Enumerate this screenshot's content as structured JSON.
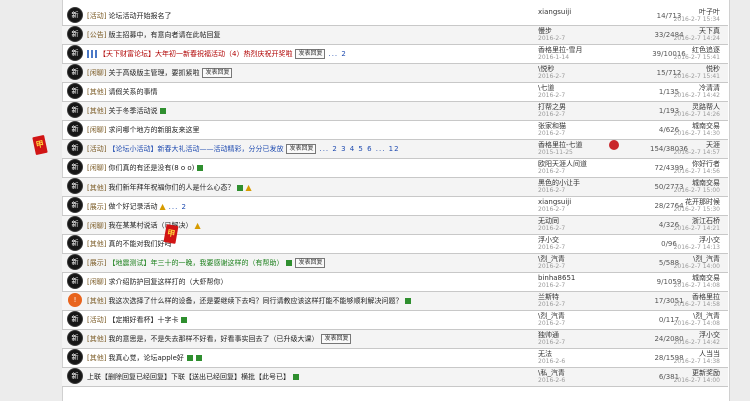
{
  "decor": {
    "envelope_glyph": "甲",
    "envelope_glyph2": "甲"
  },
  "rows": [
    {
      "badge": "新",
      "cat": "[活动]",
      "title": "论坛活动开始报名了",
      "flags": [],
      "author": "xiangsuiji",
      "date": "",
      "replies": "14/713",
      "last_user": "叶子叶",
      "last_date": "2016-2-7 15:34"
    },
    {
      "badge": "新",
      "cat": "[公告]",
      "title": "版主招募中，有意向者请在此帖回复",
      "flags": [],
      "author": "慢步",
      "date": "2016-2-7",
      "replies": "33/2484",
      "last_user": "天下真",
      "last_date": "2016-2-7 14:24"
    },
    {
      "badge": "新",
      "cat": "",
      "title": "【天下财富论坛】大年初一新春祝福活动（4）热烈庆祝开奖啦",
      "flags": [
        "chip",
        "pages"
      ],
      "chip": "发表回复",
      "pages": "... 2",
      "author": "香格里拉-雪月",
      "date": "2016-1-14",
      "replies": "39/10016",
      "last_user": "红色追逐",
      "last_date": "2016-2-7 15:41"
    },
    {
      "badge": "新",
      "cat": "[闲聊]",
      "title": "关于高级版主管理，要抓紧啦",
      "flags": [
        "chip"
      ],
      "chip": "发表回复",
      "author": "\\悦秒",
      "date": "2016-2-7",
      "replies": "15/712",
      "last_user": "悦秒",
      "last_date": "2016-2-7 15:41"
    },
    {
      "badge": "新",
      "cat": "[其他]",
      "title": "请假关系的事情",
      "flags": [],
      "author": "\\七道",
      "date": "2016-2-7",
      "replies": "1/135",
      "last_user": "冷清清",
      "last_date": "2016-2-7 14:42"
    },
    {
      "badge": "新",
      "cat": "[其他]",
      "title": "关于冬季活动说",
      "flags": [
        "sq"
      ],
      "author": "打帮之男",
      "date": "2016-2-7",
      "replies": "1/193",
      "last_user": "灵路帮人",
      "last_date": "2016-2-7 14:26"
    },
    {
      "badge": "新",
      "cat": "[闲聊]",
      "title": "求问哪个地方的新朋友来这里",
      "flags": [],
      "author": "张家和猫",
      "date": "2016-2-7",
      "replies": "4/626",
      "last_user": "城南交易",
      "last_date": "2016-2-7 14:30"
    },
    {
      "badge": "新",
      "cat": "[活动]",
      "title": "【论坛小活动】新春大礼活动——活动精彩，分分已发放",
      "flags": [
        "chip",
        "pages"
      ],
      "chip": "发表回复",
      "pages": "... 2 3 4 5 6 ... 12",
      "author": "香格里拉-七道",
      "date": "2015-11-25",
      "replies": "154/38036",
      "last_user": "天涯",
      "last_date": "2016-2-7 14:57"
    },
    {
      "badge": "新",
      "cat": "[闲聊]",
      "title": "你们真的有还是没有(8 o o)",
      "flags": [
        "sq"
      ],
      "author": "欧阳天涯人间道",
      "date": "2016-2-7",
      "replies": "72/4399",
      "last_user": "你好行者",
      "last_date": "2016-2-7 14:56"
    },
    {
      "badge": "新",
      "cat": "[其他]",
      "title": "我们新年拜年祝福你们的人是什么心态？",
      "flags": [
        "sq",
        "thumb"
      ],
      "author": "黑色的小让手",
      "date": "2016-2-7",
      "replies": "50/2773",
      "last_user": "城南交易",
      "last_date": "2016-2-7 15:00"
    },
    {
      "badge": "新",
      "cat": "[展示]",
      "title": "做个好记录活动",
      "flags": [
        "thumb",
        "pages"
      ],
      "pages": "... 2",
      "author": "xiangsuiji",
      "date": "2016-2-7",
      "replies": "28/2764",
      "last_user": "花开那时候",
      "last_date": "2016-2-7 15:30"
    },
    {
      "badge": "新",
      "cat": "[闲聊]",
      "title": "我在某某村说话（已解决）",
      "flags": [
        "thumb"
      ],
      "author": "无动同",
      "date": "2016-2-7",
      "replies": "4/326",
      "last_user": "浙江石桥",
      "last_date": "2016-2-7 14:21"
    },
    {
      "badge": "新",
      "cat": "[其他]",
      "title": "真的不能对我们好吗",
      "flags": [],
      "author": "浮小交",
      "date": "2016-2-7",
      "replies": "0/96",
      "last_user": "浮小交",
      "last_date": "2016-2-7 14:13"
    },
    {
      "badge": "新",
      "cat": "[展示]",
      "title": "【地震测试】年三十的一晚，我要感谢这样的（有帮助）",
      "flags": [
        "sq",
        "chip"
      ],
      "chip": "发表回复",
      "author": "\\烈_汽青",
      "date": "2016-2-7",
      "replies": "5/588",
      "last_user": "\\烈_汽青",
      "last_date": "2016-2-7 14:00"
    },
    {
      "badge": "新",
      "cat": "[闲聊]",
      "title": "求介绍防护回复这样打的（大虾帮你）",
      "flags": [],
      "author": "binha8651",
      "date": "2016-2-7",
      "replies": "9/1059",
      "last_user": "城南交易",
      "last_date": "2016-2-7 14:08"
    },
    {
      "badge": "!",
      "cat": "[其他]",
      "title": "我这次选择了什么样的设备，还是要继续下去吗？同行请教应该这样打能不能够顺利解决问题？",
      "flags": [
        "sq"
      ],
      "author": "兰斯特",
      "date": "2016-2-7",
      "replies": "17/3051",
      "last_user": "香格里拉",
      "last_date": "2016-2-7 14:58",
      "alert": true
    },
    {
      "badge": "新",
      "cat": "[活动]",
      "title": "【定期好看杯】十字卡",
      "flags": [
        "sq"
      ],
      "author": "\\烈_汽青",
      "date": "2016-2-7",
      "replies": "0/117",
      "last_user": "\\烈_汽青",
      "last_date": "2016-2-7 14:08"
    },
    {
      "badge": "新",
      "cat": "[其他]",
      "title": "我的意思是，不是失去那样不好看，好看事实回去了（已升级大课）",
      "flags": [
        "chip"
      ],
      "chip": "发表回复",
      "author": "独帅通",
      "date": "2016-2-7",
      "replies": "24/2080",
      "last_user": "浮小交",
      "last_date": "2016-2-7 14:42"
    },
    {
      "badge": "新",
      "cat": "[其他]",
      "title": "我真心觉，论坛apple好",
      "flags": [
        "sq",
        "sq"
      ],
      "author": "无法",
      "date": "2016-2-6",
      "replies": "28/1598",
      "last_user": "人当当",
      "last_date": "2016-2-7 14:38"
    },
    {
      "badge": "新",
      "cat": "",
      "title": "上联【删除回复已经回复】下联【送出已经回复】横批【此号已】",
      "flags": [
        "sq"
      ],
      "author": "\\私_汽青",
      "date": "2016-2-6",
      "replies": "6/381",
      "last_user": "更新奖励",
      "last_date": "2016-2-7 14:00"
    }
  ]
}
